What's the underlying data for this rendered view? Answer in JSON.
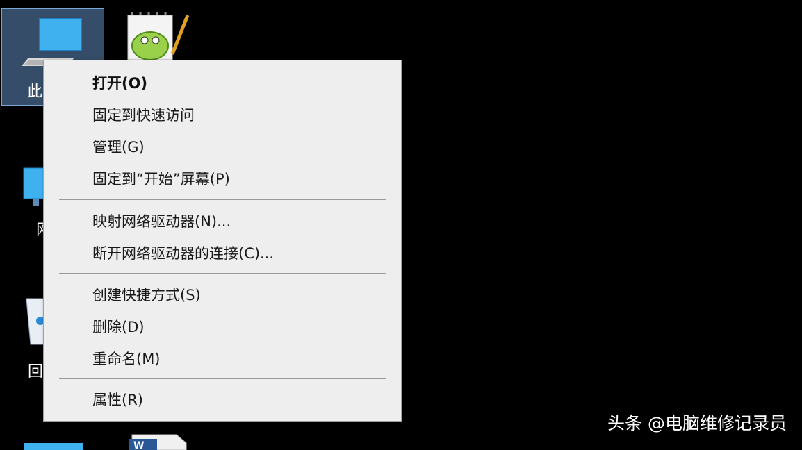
{
  "desktop": {
    "icons": [
      {
        "label": "此",
        "icon": "this-pc-icon"
      },
      {
        "label": "",
        "icon": "notepad-plus-plus-icon"
      },
      {
        "label": "网",
        "icon": "network-icon"
      },
      {
        "label": "回",
        "icon": "recycle-bin-icon"
      },
      {
        "label": "",
        "icon": "monitor-icon"
      },
      {
        "label": "",
        "icon": "word-document-icon"
      }
    ]
  },
  "context_menu": {
    "items": [
      {
        "label": "打开(O)",
        "bold": true
      },
      {
        "label": "固定到快速访问"
      },
      {
        "label": "管理(G)"
      },
      {
        "label": "固定到“开始”屏幕(P)"
      },
      {
        "label": "映射网络驱动器(N)..."
      },
      {
        "label": "断开网络驱动器的连接(C)..."
      },
      {
        "label": "创建快捷方式(S)"
      },
      {
        "label": "删除(D)"
      },
      {
        "label": "重命名(M)"
      },
      {
        "label": "属性(R)"
      }
    ]
  },
  "watermark": "头条 @电脑维修记录员",
  "colors": {
    "desktop_bg": "#000000",
    "menu_bg": "#eeeeee",
    "selection_tile": "#608cbe"
  }
}
